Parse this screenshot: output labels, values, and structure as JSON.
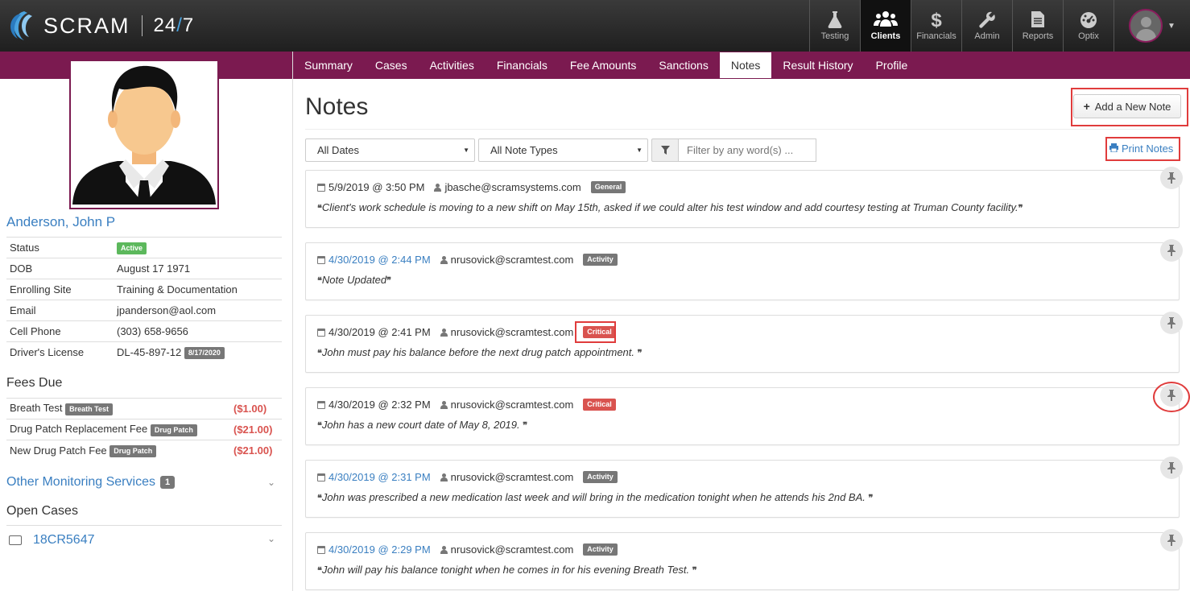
{
  "brand": {
    "name": "SCRAM",
    "product_prefix": "24",
    "product_slash": "/",
    "product_suffix": "7"
  },
  "top_nav": [
    {
      "label": "Testing",
      "icon": "flask-icon"
    },
    {
      "label": "Clients",
      "icon": "users-icon",
      "active": true
    },
    {
      "label": "Financials",
      "icon": "dollar-icon"
    },
    {
      "label": "Admin",
      "icon": "wrench-icon"
    },
    {
      "label": "Reports",
      "icon": "file-icon"
    },
    {
      "label": "Optix",
      "icon": "dashboard-icon"
    }
  ],
  "tabs": [
    "Summary",
    "Cases",
    "Activities",
    "Financials",
    "Fee Amounts",
    "Sanctions",
    "Notes",
    "Result History",
    "Profile"
  ],
  "active_tab": "Notes",
  "client": {
    "name": "Anderson, John P",
    "info": [
      {
        "key": "Status",
        "value": "",
        "badge": "Active"
      },
      {
        "key": "DOB",
        "value": "August 17 1971"
      },
      {
        "key": "Enrolling Site",
        "value": "Training & Documentation"
      },
      {
        "key": "Email",
        "value": "jpanderson@aol.com"
      },
      {
        "key": "Cell Phone",
        "value": "(303) 658-9656"
      },
      {
        "key": "Driver's License",
        "value": "DL-45-897-12",
        "badge": "8/17/2020"
      }
    ]
  },
  "fees": {
    "title": "Fees Due",
    "items": [
      {
        "label": "Breath Test",
        "badge": "Breath Test",
        "amount": "($1.00)"
      },
      {
        "label": "Drug Patch Replacement Fee",
        "badge": "Drug Patch",
        "amount": "($21.00)"
      },
      {
        "label": "New Drug Patch Fee",
        "badge": "Drug Patch",
        "amount": "($21.00)"
      }
    ]
  },
  "other_services": {
    "label": "Other Monitoring Services",
    "count": "1"
  },
  "open_cases": {
    "title": "Open Cases",
    "case": "18CR5647"
  },
  "main": {
    "title": "Notes",
    "add_button": "Add a New Note",
    "date_filter": "All Dates",
    "type_filter": "All Note Types",
    "search_placeholder": "Filter by any word(s) ...",
    "print_link": "Print Notes"
  },
  "notes": [
    {
      "date": "5/9/2019 @ 3:50 PM",
      "date_link": false,
      "user": "jbasche@scramsystems.com",
      "type": "General",
      "text": "Client's work schedule is moving to a new shift on May 15th, asked if we could alter his test window and add courtesy testing at Truman County facility."
    },
    {
      "date": "4/30/2019 @ 2:44 PM",
      "date_link": true,
      "user": "nrusovick@scramtest.com",
      "type": "Activity",
      "text": "Note Updated"
    },
    {
      "date": "4/30/2019 @ 2:41 PM",
      "date_link": false,
      "user": "nrusovick@scramtest.com",
      "type": "Critical",
      "text": "John must pay his balance before the next drug patch appointment. "
    },
    {
      "date": "4/30/2019 @ 2:32 PM",
      "date_link": false,
      "user": "nrusovick@scramtest.com",
      "type": "Critical",
      "text": "John has a new court date of May 8, 2019. "
    },
    {
      "date": "4/30/2019 @ 2:31 PM",
      "date_link": true,
      "user": "nrusovick@scramtest.com",
      "type": "Activity",
      "text": "John was prescribed a new medication last week and will bring in the medication tonight when he attends his 2nd BA. "
    },
    {
      "date": "4/30/2019 @ 2:29 PM",
      "date_link": true,
      "user": "nrusovick@scramtest.com",
      "type": "Activity",
      "text": "John will pay his balance tonight when he comes in for his evening Breath Test. "
    }
  ],
  "colors": {
    "brand_purple": "#7b1a50",
    "link_blue": "#3a7fc1",
    "critical_red": "#d9534f",
    "active_green": "#5cb85c",
    "highlight_red": "#e03c3c"
  }
}
